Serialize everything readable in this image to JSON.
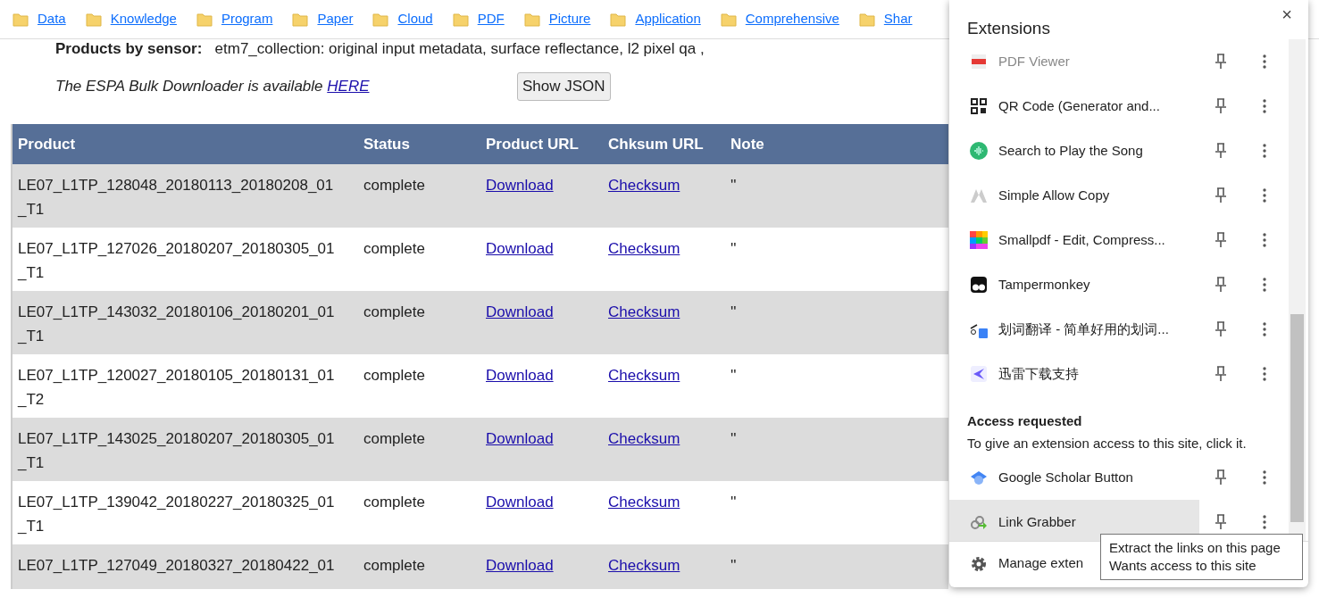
{
  "bookmarks": [
    "Data",
    "Knowledge",
    "Program",
    "Paper",
    "Cloud",
    "PDF",
    "Picture",
    "Application",
    "Comprehensive",
    "Shar"
  ],
  "sensor_line": {
    "label": "Products by sensor:",
    "value": "etm7_collection: original input metadata, surface reflectance, l2 pixel qa ,"
  },
  "downloader": {
    "text": "The ESPA Bulk Downloader is available ",
    "link": "HERE"
  },
  "show_json_button": "Show JSON",
  "table": {
    "columns": [
      "Product",
      "Status",
      "Product URL",
      "Chksum URL",
      "Note"
    ],
    "rows": [
      {
        "product_lines": [
          "LE07_L1TP_128048_20180113_20180208_01",
          "_T1"
        ],
        "status": "complete",
        "product_url": "Download",
        "chksum_url": "Checksum",
        "note": "''"
      },
      {
        "product_lines": [
          "LE07_L1TP_127026_20180207_20180305_01",
          "_T1"
        ],
        "status": "complete",
        "product_url": "Download",
        "chksum_url": "Checksum",
        "note": "''"
      },
      {
        "product_lines": [
          "LE07_L1TP_143032_20180106_20180201_01",
          "_T1"
        ],
        "status": "complete",
        "product_url": "Download",
        "chksum_url": "Checksum",
        "note": "''"
      },
      {
        "product_lines": [
          "LE07_L1TP_120027_20180105_20180131_01",
          "_T2"
        ],
        "status": "complete",
        "product_url": "Download",
        "chksum_url": "Checksum",
        "note": "''"
      },
      {
        "product_lines": [
          "LE07_L1TP_143025_20180207_20180305_01",
          "_T1"
        ],
        "status": "complete",
        "product_url": "Download",
        "chksum_url": "Checksum",
        "note": "''"
      },
      {
        "product_lines": [
          "LE07_L1TP_139042_20180227_20180325_01",
          "_T1"
        ],
        "status": "complete",
        "product_url": "Download",
        "chksum_url": "Checksum",
        "note": "''"
      },
      {
        "product_lines": [
          "LE07_L1TP_127049_20180327_20180422_01"
        ],
        "status": "complete",
        "product_url": "Download",
        "chksum_url": "Checksum",
        "note": "''"
      }
    ]
  },
  "extensions_popup": {
    "title": "Extensions",
    "close": "×",
    "items": [
      {
        "name": "PDF Viewer",
        "dimmed": true,
        "highlighted": false
      },
      {
        "name": "QR Code (Generator and...",
        "dimmed": false,
        "highlighted": false
      },
      {
        "name": "Search to Play the Song",
        "dimmed": false,
        "highlighted": false
      },
      {
        "name": "Simple Allow Copy",
        "dimmed": false,
        "highlighted": false
      },
      {
        "name": "Smallpdf - Edit, Compress...",
        "dimmed": false,
        "highlighted": false
      },
      {
        "name": "Tampermonkey",
        "dimmed": false,
        "highlighted": false
      },
      {
        "name": "划词翻译 - 简单好用的划词...",
        "dimmed": false,
        "highlighted": false
      },
      {
        "name": "迅雷下载支持",
        "dimmed": false,
        "highlighted": false
      }
    ],
    "access_heading": "Access requested",
    "access_hint": "To give an extension access to this site, click it.",
    "access_items": [
      {
        "name": "Google Scholar Button",
        "dimmed": false,
        "highlighted": false
      },
      {
        "name": "Link Grabber",
        "dimmed": false,
        "highlighted": true
      }
    ],
    "manage": "Manage exten",
    "tooltip": [
      "Extract the links on this page",
      "Wants access to this site"
    ]
  }
}
